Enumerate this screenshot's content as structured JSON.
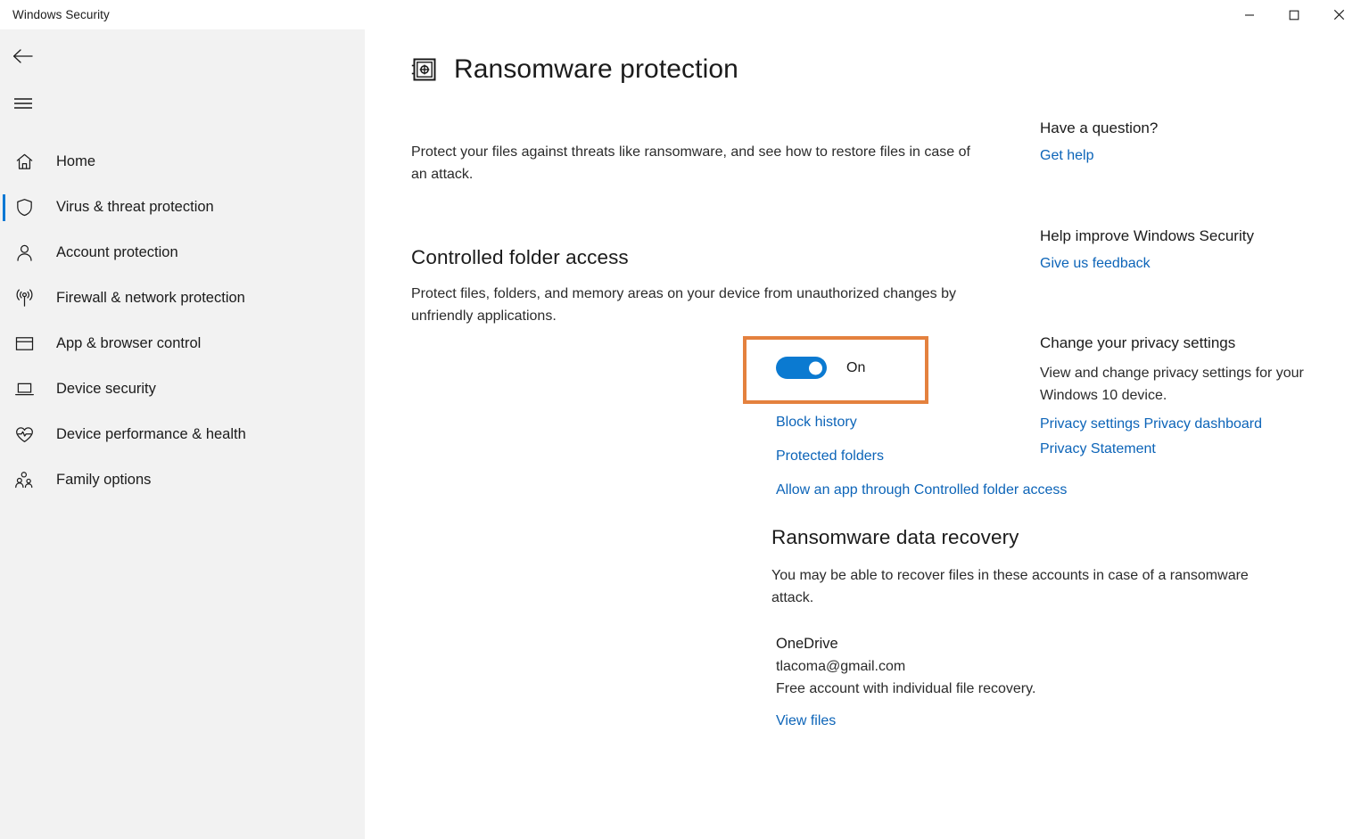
{
  "window": {
    "title": "Windows Security",
    "controls": [
      {
        "name": "minimize",
        "glyph": "minimize-icon"
      },
      {
        "name": "maximize",
        "glyph": "maximize-icon"
      },
      {
        "name": "close",
        "glyph": "close-icon"
      }
    ]
  },
  "sidebar": {
    "back_icon": "back-arrow-icon",
    "menu_icon": "hamburger-menu-icon",
    "items": [
      {
        "label": "Home",
        "icon": "home-icon",
        "selected": false
      },
      {
        "label": "Virus & threat protection",
        "icon": "shield-icon",
        "selected": true
      },
      {
        "label": "Account protection",
        "icon": "person-icon",
        "selected": false
      },
      {
        "label": "Firewall & network protection",
        "icon": "broadcast-icon",
        "selected": false
      },
      {
        "label": "App & browser control",
        "icon": "window-icon",
        "selected": false
      },
      {
        "label": "Device security",
        "icon": "laptop-icon",
        "selected": false
      },
      {
        "label": "Device performance & health",
        "icon": "heart-pulse-icon",
        "selected": false
      },
      {
        "label": "Family options",
        "icon": "people-icon",
        "selected": false
      }
    ]
  },
  "main": {
    "page_icon": "vault-icon",
    "page_title": "Ransomware protection",
    "page_description": "Protect your files against threats like ransomware, and see how to restore files in case of an attack.",
    "controlled_folder_access": {
      "title": "Controlled folder access",
      "description": "Protect files, folders, and memory areas on your device from unauthorized changes by unfriendly applications.",
      "toggle_state": "On",
      "toggle_label": "On",
      "links": [
        "Block history",
        "Protected folders",
        "Allow an app through Controlled folder access"
      ]
    },
    "ransomware_data_recovery": {
      "title": "Ransomware data recovery",
      "description": "You may be able to recover files in these accounts in case of a ransomware attack.",
      "account_name": "OneDrive",
      "account_email": "tlacoma@gmail.com",
      "account_note": "Free account with individual file recovery.",
      "view_files_link": "View files"
    }
  },
  "right_rail": {
    "groups": [
      {
        "title": "Have a question?",
        "body": "",
        "links": [
          "Get help"
        ]
      },
      {
        "title": "Help improve Windows Security",
        "body": "",
        "links": [
          "Give us feedback"
        ]
      },
      {
        "title": "Change your privacy settings",
        "body": "View and change privacy settings for your Windows 10 device.",
        "links": [
          "Privacy settings",
          "Privacy dashboard",
          "Privacy Statement"
        ]
      }
    ]
  },
  "colors": {
    "accent_blue": "#0078d4",
    "toggle_blue": "#0b7ad1",
    "link_blue": "#0c64b8",
    "highlight_orange": "#e4813e",
    "sidebar_bg": "#f2f2f2",
    "content_bg": "#ffffff",
    "text_primary": "#1b1b1b"
  }
}
